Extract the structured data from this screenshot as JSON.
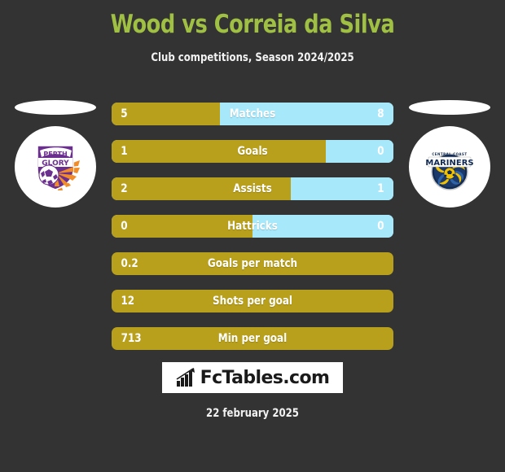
{
  "header": {
    "title": "Wood vs Correia da Silva",
    "subtitle": "Club competitions, Season 2024/2025",
    "title_color": "#9fc042"
  },
  "teams": {
    "home": {
      "name": "Perth Glory",
      "crest_icon": "perth-glory-crest-icon",
      "colors": {
        "primary": "#6b2f8f",
        "accent": "#f28c28"
      },
      "bar_color": "#b8a01c"
    },
    "away": {
      "name": "Central Coast Mariners",
      "crest_icon": "central-coast-mariners-crest-icon",
      "colors": {
        "primary": "#122b54",
        "accent": "#f2c200"
      },
      "bar_color": "#a8e8fb"
    }
  },
  "chart_data": {
    "type": "bar",
    "title": "Wood vs Correia da Silva",
    "subtitle": "Club competitions, Season 2024/2025",
    "orientation": "horizontal-diverging",
    "categories": [
      "Matches",
      "Goals",
      "Assists",
      "Hattricks",
      "Goals per match",
      "Shots per goal",
      "Min per goal"
    ],
    "series": [
      {
        "name": "Wood",
        "values": [
          "5",
          "1",
          "2",
          "0",
          "0.2",
          "12",
          "713"
        ]
      },
      {
        "name": "Correia da Silva",
        "values": [
          "8",
          "0",
          "1",
          "0",
          null,
          null,
          null
        ]
      }
    ],
    "rows": [
      {
        "label": "Matches",
        "home": "5",
        "away": "8",
        "home_pct": 38.5,
        "split": true
      },
      {
        "label": "Goals",
        "home": "1",
        "away": "0",
        "home_pct": 76.0,
        "split": true
      },
      {
        "label": "Assists",
        "home": "2",
        "away": "1",
        "home_pct": 63.5,
        "split": true
      },
      {
        "label": "Hattricks",
        "home": "0",
        "away": "0",
        "home_pct": 50.0,
        "split": true
      },
      {
        "label": "Goals per match",
        "home": "0.2",
        "away": null,
        "home_pct": 100,
        "split": false
      },
      {
        "label": "Shots per goal",
        "home": "12",
        "away": null,
        "home_pct": 100,
        "split": false
      },
      {
        "label": "Min per goal",
        "home": "713",
        "away": null,
        "home_pct": 100,
        "split": false
      }
    ],
    "legend_position": "none",
    "grid": false
  },
  "footer": {
    "logo_text": "FcTables.com",
    "logo_icon": "bar-chart-icon",
    "date": "22 february 2025"
  }
}
